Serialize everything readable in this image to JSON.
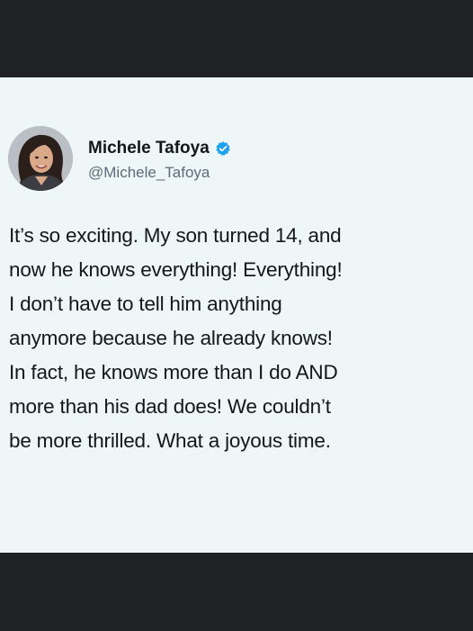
{
  "tweet": {
    "author_name": "Michele Tafoya",
    "handle": "@Michele_Tafoya",
    "verified": true,
    "avatar_icon": "profile-photo",
    "verified_icon": "verified-badge-icon",
    "text_lines": [
      "It’s so exciting.  My son turned 14, and",
      "now he knows everything!  Everything!",
      "I don’t have to tell him anything",
      "anymore because he already knows!",
      "In fact, he knows more than I do AND",
      "more than his dad does!  We couldn’t",
      "be more thrilled.  What a joyous time."
    ]
  },
  "colors": {
    "background": "#202124",
    "card": "#eef6f8",
    "text": "#14171a",
    "handle": "#5b6b78",
    "verified": "#1da1f2"
  }
}
